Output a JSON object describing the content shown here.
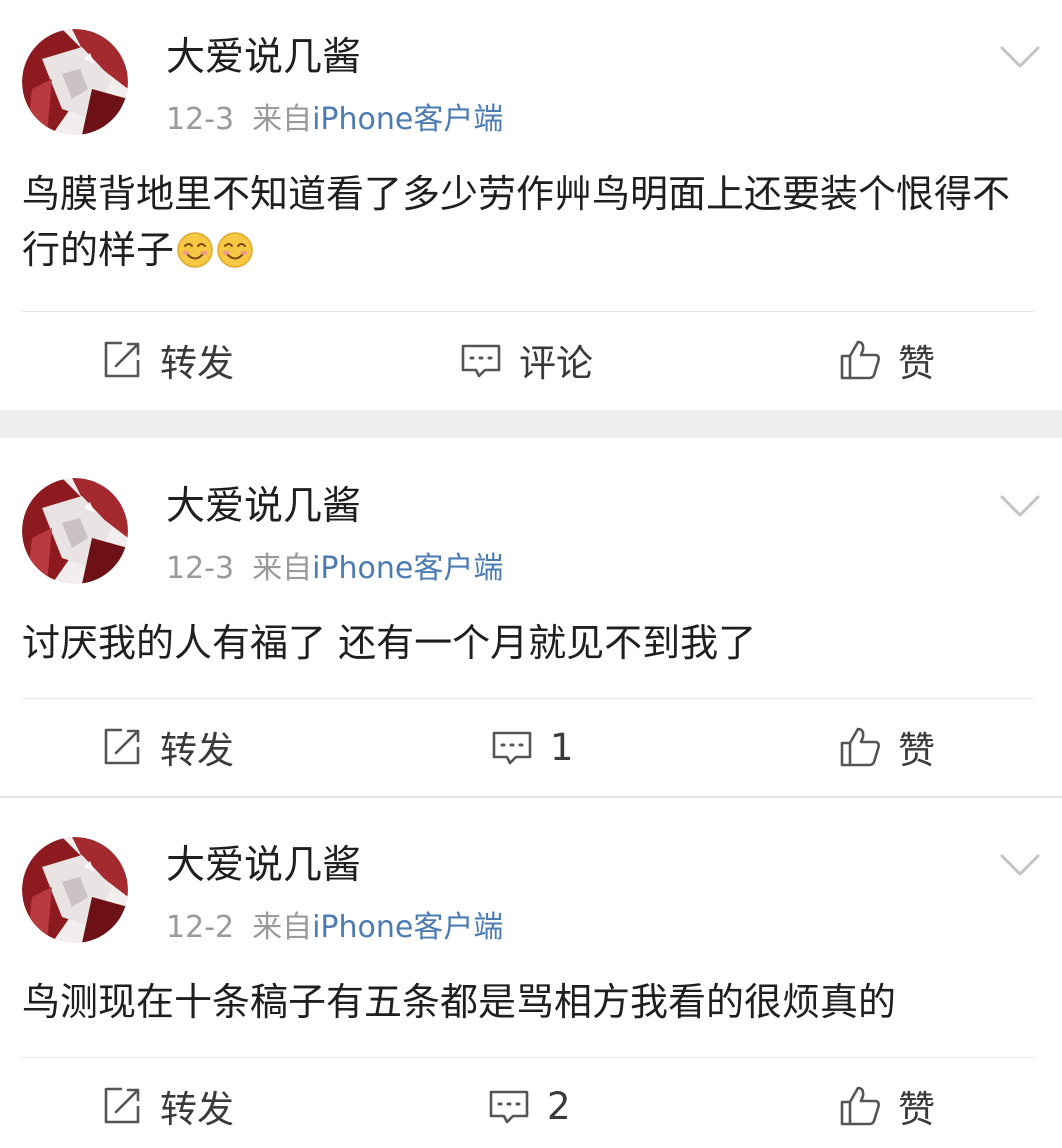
{
  "colors": {
    "name": "#1f1f1f",
    "meta_gray": "#9a9a9a",
    "client_link": "#4d7cb3",
    "separator": "#efefef"
  },
  "posts": [
    {
      "author": "大爱说几酱",
      "date": "12-3",
      "source_prefix": "来自",
      "source_client": "iPhone客户端",
      "text": "鸟膜背地里不知道看了多少劳作艸鸟明面上还要装个恨得不行的样子",
      "emojis": [
        "smile-emoji",
        "smile-emoji"
      ],
      "actions": {
        "repost": "转发",
        "comment": "评论",
        "like": "赞"
      }
    },
    {
      "author": "大爱说几酱",
      "date": "12-3",
      "source_prefix": "来自",
      "source_client": "iPhone客户端",
      "text": "讨厌我的人有福了 还有一个月就见不到我了",
      "emojis": [],
      "actions": {
        "repost": "转发",
        "comment": "1",
        "like": "赞"
      }
    },
    {
      "author": "大爱说几酱",
      "date": "12-2",
      "source_prefix": "来自",
      "source_client": "iPhone客户端",
      "text": "鸟测现在十条稿子有五条都是骂相方我看的很烦真的",
      "emojis": [],
      "actions": {
        "repost": "转发",
        "comment": "2",
        "like": "赞"
      }
    }
  ]
}
